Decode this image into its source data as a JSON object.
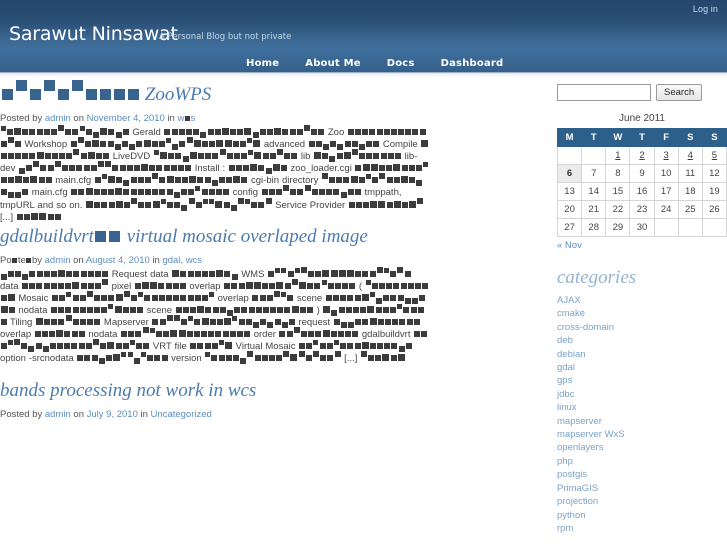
{
  "topbar": {
    "login_label": "Log in"
  },
  "header": {
    "site_title": "Sarawut Ninsawat",
    "site_description": "A Personal Blog but not private"
  },
  "nav": {
    "items": [
      {
        "label": "Home"
      },
      {
        "label": "About Me"
      },
      {
        "label": "Docs"
      },
      {
        "label": "Dashboard"
      }
    ]
  },
  "posts": [
    {
      "title_visible_text": "ZooWPS",
      "title_leading_tofu": 10,
      "meta_prefix": "Posted by",
      "meta_author": "admin",
      "meta_mid": "on",
      "meta_date": "November 4, 2010",
      "meta_in": "in",
      "meta_categories": "wps",
      "body_words": [
        "Gerald",
        "Zoo",
        "Workshop",
        "advanced",
        "Compile",
        "LiveDVD",
        "lib",
        "lib-dev",
        "Install :",
        "zoo_loader.cgi",
        "main.cfg",
        "cgi-bin directory",
        "main.cfg",
        "config",
        "tmppath, tmpURL and so on.",
        "Service Provider",
        "[...]"
      ]
    },
    {
      "title_visible_text": "gdalbuildvrt  virtual mosaic overlaped image",
      "title_part_a": "gdalbuildvrt",
      "title_part_b": "virtual mosaic overlaped image",
      "meta_prefix": "Posted by",
      "meta_author": "admin",
      "meta_mid": "on",
      "meta_date": "August 4, 2010",
      "meta_in": "in",
      "meta_categories": "gdal, wcs",
      "body_words": [
        "Request data",
        "WMS",
        "data",
        "pixel",
        "overlap",
        "(",
        "Mosaic",
        "overlap",
        "scene",
        "nodata",
        "scene",
        ")",
        "Tiling",
        "Mapserver",
        "request",
        "overlap",
        "nodata",
        "order",
        "gdalbuildvrt",
        "VRT file",
        "Virtual Mosaic",
        "option -srcnodata",
        "version",
        "[...]"
      ]
    },
    {
      "title_visible_text": "bands processing not work in wcs",
      "meta_prefix": "Posted by",
      "meta_author": "admin",
      "meta_mid": "on",
      "meta_date": "July 9, 2010",
      "meta_in": "in",
      "meta_categories": "Uncategorized"
    }
  ],
  "sidebar": {
    "search": {
      "value": "",
      "placeholder": "",
      "button_label": "Search"
    },
    "calendar": {
      "caption": "June 2011",
      "weekdays": [
        "M",
        "T",
        "W",
        "T",
        "F",
        "S",
        "S"
      ],
      "weeks": [
        [
          "",
          "",
          "1",
          "2",
          "3",
          "4",
          "5"
        ],
        [
          "6",
          "7",
          "8",
          "9",
          "10",
          "11",
          "12"
        ],
        [
          "13",
          "14",
          "15",
          "16",
          "17",
          "18",
          "19"
        ],
        [
          "20",
          "21",
          "22",
          "23",
          "24",
          "25",
          "26"
        ],
        [
          "27",
          "28",
          "29",
          "30",
          "",
          "",
          ""
        ]
      ],
      "today": "6",
      "linked_days": [
        "1",
        "2",
        "3",
        "4",
        "5"
      ],
      "prev_label": "« Nov"
    },
    "categories": {
      "title": "categories",
      "items": [
        "AJAX",
        "cmake",
        "cross-domain",
        "deb",
        "debian",
        "gdal",
        "gps",
        "jdbc",
        "linux",
        "mapserver",
        "mapserver WxS",
        "openlayers",
        "php",
        "postgis",
        "PrimaGIS",
        "projection",
        "python",
        "rpm"
      ]
    }
  },
  "colors": {
    "header_dark": "#24466a",
    "header_mid": "#3b6690",
    "nav_blue": "#35608c",
    "link_blue": "#5c8fc0",
    "title_blue": "#4a7bb0",
    "category_blue": "#7ba2c9",
    "calendar_header": "#2d5f8b",
    "tofu_dark": "#3c3c3c",
    "tofu_blue": "#39648f"
  }
}
